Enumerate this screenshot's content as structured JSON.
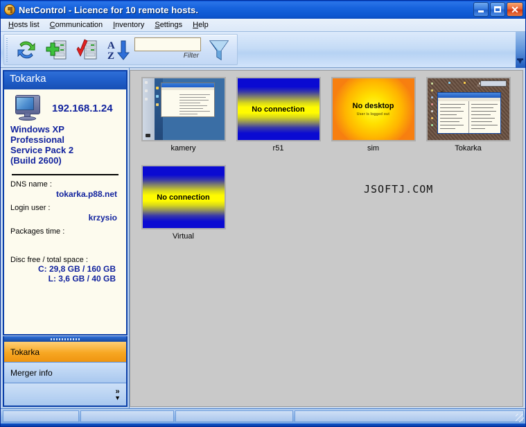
{
  "window": {
    "title": "NetControl - Licence for 10 remote hosts.",
    "icon": "netcontrol-app-icon",
    "buttons": {
      "minimize": "minimize-button",
      "maximize": "maximize-button",
      "close": "close-button",
      "close_glyph": "✕"
    }
  },
  "menubar": {
    "items": [
      {
        "label": "Hosts list",
        "accel": "H"
      },
      {
        "label": "Communication",
        "accel": "C"
      },
      {
        "label": "Inventory",
        "accel": "I"
      },
      {
        "label": "Settings",
        "accel": "S"
      },
      {
        "label": "Help",
        "accel": "H"
      }
    ]
  },
  "toolbar": {
    "buttons": [
      {
        "name": "refresh-button",
        "icon": "refresh-arrows-icon",
        "tooltip": "Refresh"
      },
      {
        "name": "add-host-button",
        "icon": "server-add-icon",
        "tooltip": "Add host"
      },
      {
        "name": "check-host-button",
        "icon": "server-check-icon",
        "tooltip": "Check host"
      },
      {
        "name": "sort-button",
        "icon": "sort-az-icon",
        "tooltip": "Sort A-Z"
      }
    ],
    "filter": {
      "value": "",
      "placeholder": "",
      "label": "Filter"
    },
    "filter_button": {
      "name": "filter-funnel-button",
      "icon": "funnel-icon"
    },
    "overflow": {
      "name": "toolbar-overflow-button",
      "icon": "toolbar-overflow-icon"
    }
  },
  "left_panel": {
    "header_title": "Tokarka",
    "host": {
      "ip": "192.168.1.24",
      "os_lines": [
        "Windows XP",
        "Professional",
        "Service Pack 2",
        "(Build 2600)"
      ]
    },
    "details": [
      {
        "label": "DNS name :",
        "value": "tokarka.p88.net"
      },
      {
        "label": "Login user :",
        "value": "krzysio"
      },
      {
        "label": "Packages time :",
        "value": ""
      }
    ],
    "disc": {
      "label": "Disc free / total space :",
      "lines": [
        "C: 29,8 GB / 160 GB",
        "L: 3,6 GB / 40 GB"
      ]
    },
    "tabs": [
      {
        "label": "Tokarka",
        "selected": true
      },
      {
        "label": "Merger info",
        "selected": false
      }
    ],
    "expander": {
      "glyph_right": "»",
      "glyph_down": "▼"
    }
  },
  "content": {
    "watermark": "JSOFTJ.COM",
    "thumbnails": [
      {
        "caption": "kamery",
        "art": "desktop-blue",
        "status_text": ""
      },
      {
        "caption": "r51",
        "art": "no-connection",
        "status_text": "No connection"
      },
      {
        "caption": "sim",
        "art": "no-desktop",
        "status_text": "No desktop",
        "status_subtext": "User is logged out"
      },
      {
        "caption": "Tokarka",
        "art": "desktop-brown",
        "status_text": ""
      },
      {
        "caption": "Virtual",
        "art": "no-connection",
        "status_text": "No connection"
      }
    ]
  },
  "statusbar": {
    "panels": [
      "",
      "",
      "",
      ""
    ],
    "grip": "resize-grip"
  },
  "colors": {
    "title_blue": "#0a52d4",
    "accent_orange": "#f7a723",
    "info_text_blue": "#12239e",
    "panel_cream": "#fdfbee",
    "content_gray": "#c9c9c9"
  }
}
